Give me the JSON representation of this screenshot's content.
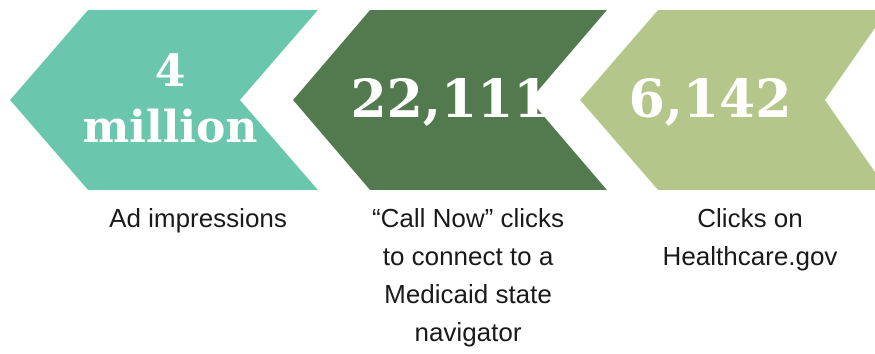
{
  "colors": {
    "teal": "#6bc6ae",
    "dark_green": "#537a4e",
    "sage": "#b5c68a",
    "value_text": "#ffffff",
    "caption_text": "#1a1a1a"
  },
  "stats": [
    {
      "value_lines": [
        "4",
        "million"
      ],
      "caption_lines": [
        "Ad impressions"
      ]
    },
    {
      "value_lines": [
        "22,111"
      ],
      "caption_lines": [
        "“Call Now” clicks",
        "to connect to a",
        "Medicaid state",
        "navigator"
      ]
    },
    {
      "value_lines": [
        "6,142"
      ],
      "caption_lines": [
        "Clicks on",
        "Healthcare.gov"
      ]
    }
  ]
}
